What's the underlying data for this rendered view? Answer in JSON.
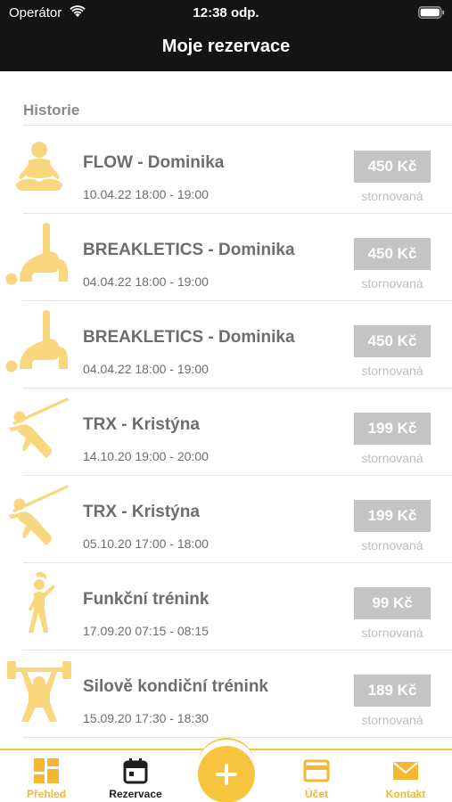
{
  "status_bar": {
    "carrier": "Operátor",
    "time": "12:38 odp.",
    "wifi_icon": "wifi-icon",
    "battery_icon": "battery-icon"
  },
  "nav": {
    "title": "Moje rezervace"
  },
  "section": {
    "title": "Historie"
  },
  "reservations": [
    {
      "title": "FLOW - Dominika",
      "time": "10.04.22 18:00 - 19:00",
      "price": "450 Kč",
      "status": "stornovaná",
      "icon": "yoga-meditation-icon"
    },
    {
      "title": "BREAKLETICS - Dominika",
      "time": "04.04.22 18:00 - 19:00",
      "price": "450 Kč",
      "status": "stornovaná",
      "icon": "breakletics-exercise-icon"
    },
    {
      "title": "BREAKLETICS - Dominika",
      "time": "04.04.22 18:00 - 19:00",
      "price": "450 Kč",
      "status": "stornovaná",
      "icon": "breakletics-exercise-icon"
    },
    {
      "title": "TRX - Kristýna",
      "time": "14.10.20 19:00 - 20:00",
      "price": "199 Kč",
      "status": "stornovaná",
      "icon": "trx-suspension-icon"
    },
    {
      "title": "TRX - Kristýna",
      "time": "05.10.20 17:00 - 18:00",
      "price": "199 Kč",
      "status": "stornovaná",
      "icon": "trx-suspension-icon"
    },
    {
      "title": "Funkční trénink",
      "time": "17.09.20 07:15 - 08:15",
      "price": "99 Kč",
      "status": "stornovaná",
      "icon": "functional-stretch-icon"
    },
    {
      "title": "Silově kondiční trénink",
      "time": "15.09.20 17:30 - 18:30",
      "price": "189 Kč",
      "status": "stornovaná",
      "icon": "weightlifting-icon"
    }
  ],
  "tabs": [
    {
      "label": "Přehled",
      "icon": "dashboard-grid-icon",
      "active": false
    },
    {
      "label": "Rezervace",
      "icon": "calendar-icon",
      "active": true
    },
    {
      "label": "Účet",
      "icon": "credit-card-icon",
      "active": false
    },
    {
      "label": "Kontakt",
      "icon": "envelope-icon",
      "active": false
    }
  ],
  "fab": {
    "icon": "plus-icon"
  },
  "colors": {
    "accent": "#f6c43f",
    "header_bg": "#141414",
    "price_badge": "#c4c4c4",
    "text_gray": "#6d6d6d",
    "status_gray": "#bdbdbd"
  }
}
